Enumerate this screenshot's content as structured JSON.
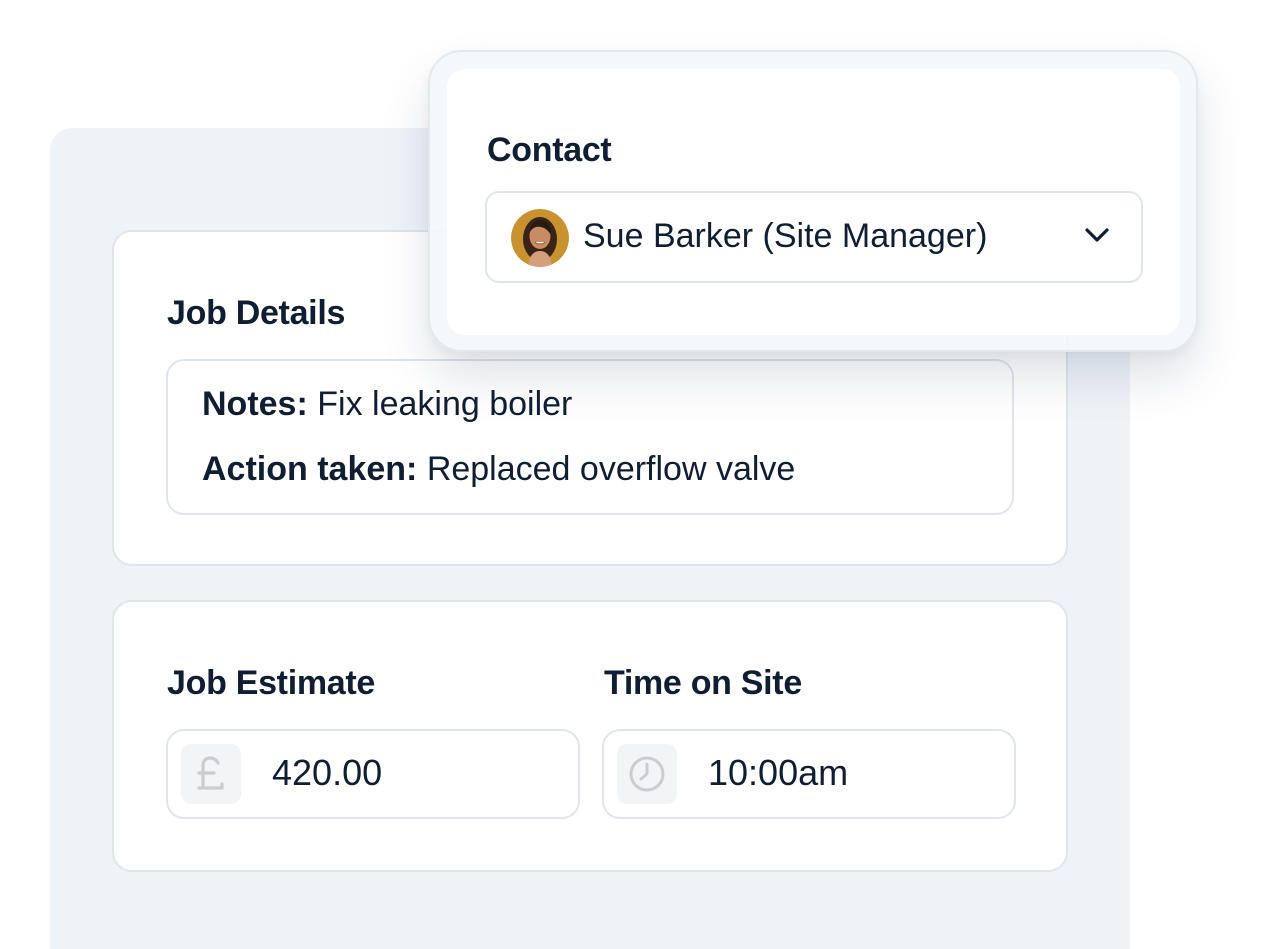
{
  "contact": {
    "label": "Contact",
    "selected_value": "Sue Barker (Site Manager)",
    "avatar_icon": "person-avatar",
    "dropdown_icon": "chevron-down-icon"
  },
  "job_details": {
    "title": "Job Details",
    "notes_label": "Notes:",
    "notes_value": "Fix leaking boiler",
    "action_label": "Action taken:",
    "action_value": "Replaced overflow valve"
  },
  "job_estimate": {
    "title": "Job Estimate",
    "icon": "pound-sign-icon",
    "value": "420.00"
  },
  "time_on_site": {
    "title": "Time on Site",
    "icon": "clock-icon",
    "value": "10:00am"
  },
  "colors": {
    "text": "#0f1e33",
    "panel_background": "#eef3f8",
    "border": "#dfe5ec",
    "icon_gray": "#c9ccd1"
  }
}
